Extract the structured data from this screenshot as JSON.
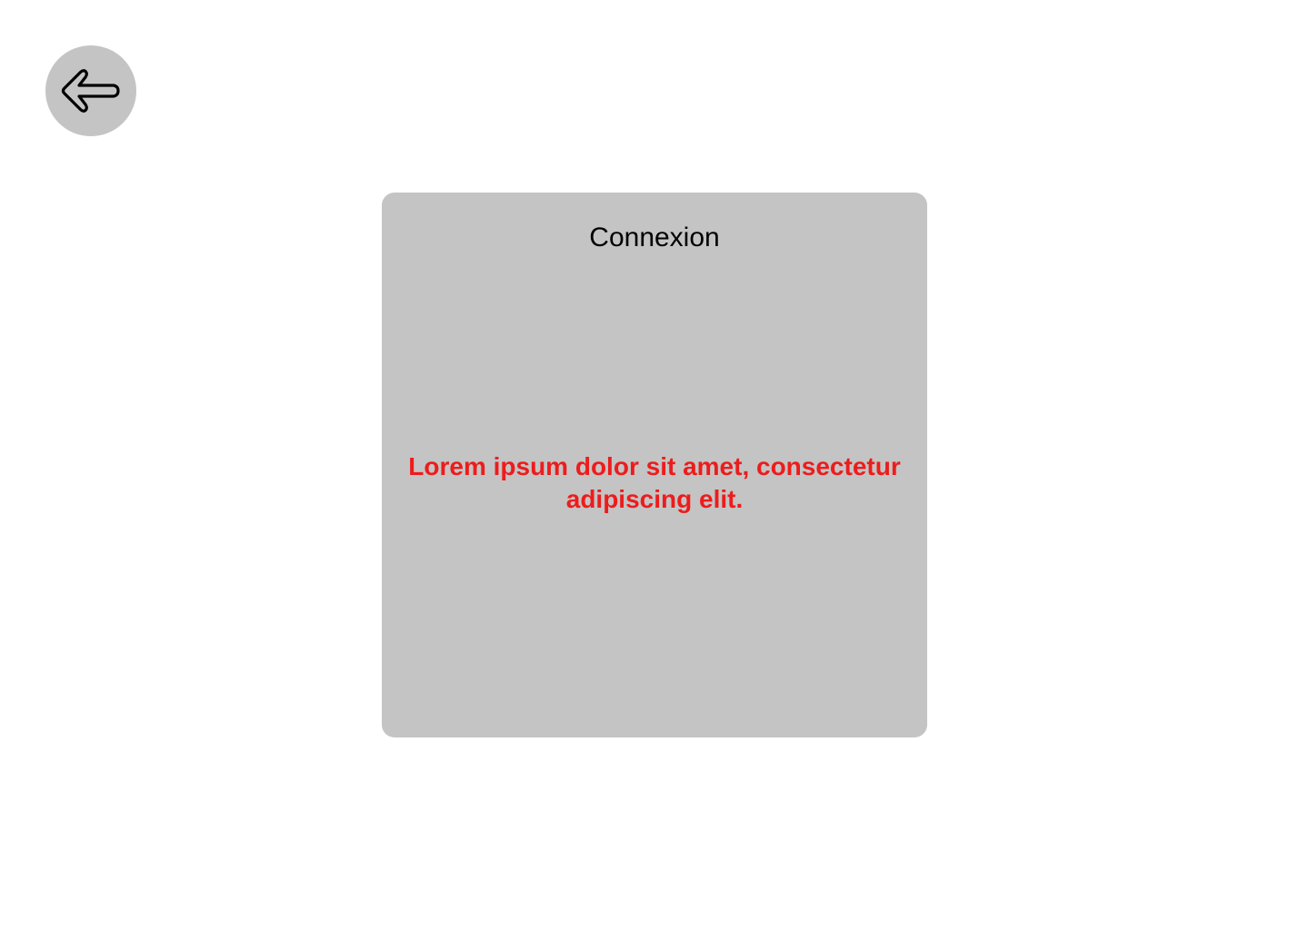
{
  "back": {
    "icon": "arrow-left-icon"
  },
  "card": {
    "title": "Connexion",
    "error_message": "Lorem ipsum dolor sit amet, consectetur adipiscing elit.",
    "error_color": "#ED1C1C",
    "background_color": "#C4C4C4"
  }
}
